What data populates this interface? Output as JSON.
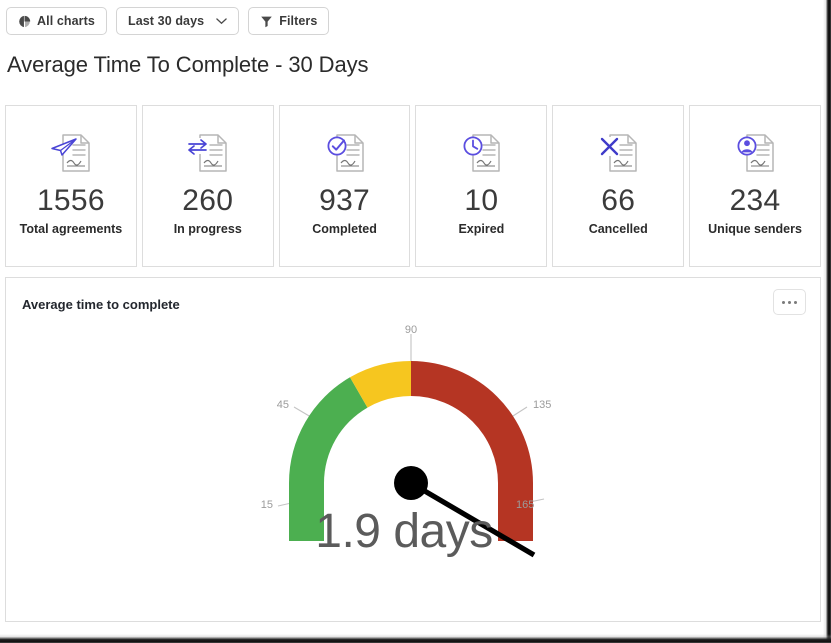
{
  "toolbar": {
    "all_charts": {
      "label": "All charts",
      "icon": "pie-chart-icon"
    },
    "date_range": {
      "label": "Last 30 days",
      "icon": "chevron-down-icon"
    },
    "filters": {
      "label": "Filters",
      "icon": "funnel-icon"
    }
  },
  "page": {
    "title": "Average Time To Complete - 30 Days"
  },
  "stats": [
    {
      "value": "1556",
      "label": "Total agreements",
      "icon": "paper-plane-document-icon",
      "accent": "#4a45d6"
    },
    {
      "value": "260",
      "label": "In progress",
      "icon": "exchange-arrows-document-icon",
      "accent": "#4a45d6"
    },
    {
      "value": "937",
      "label": "Completed",
      "icon": "check-circle-document-icon",
      "accent": "#5b4ee0"
    },
    {
      "value": "10",
      "label": "Expired",
      "icon": "clock-document-icon",
      "accent": "#5b4ee0"
    },
    {
      "value": "66",
      "label": "Cancelled",
      "icon": "x-mark-document-icon",
      "accent": "#3f3bc9"
    },
    {
      "value": "234",
      "label": "Unique senders",
      "icon": "person-circle-document-icon",
      "accent": "#5b4ee0"
    }
  ],
  "chart": {
    "title": "Average time to complete",
    "more_icon": "ellipsis-icon"
  },
  "chart_data": {
    "type": "gauge",
    "title": "Average time to complete",
    "value": 1.9,
    "value_label": "1.9 days",
    "unit": "days",
    "min": 0,
    "max": 180,
    "ticks": [
      15,
      45,
      90,
      135,
      165
    ],
    "tick_labels": [
      "15",
      "45",
      "90",
      "135",
      "165"
    ],
    "needle_angle_deg": 149,
    "bands": [
      {
        "name": "good",
        "from": 0,
        "to": 60,
        "color": "#4caf50"
      },
      {
        "name": "warning",
        "from": 60,
        "to": 90,
        "color": "#f6c61f"
      },
      {
        "name": "bad",
        "from": 90,
        "to": 180,
        "color": "#b53523"
      }
    ],
    "legend": "none",
    "grid": false
  },
  "colors": {
    "green": "#4caf50",
    "yellow": "#f6c61f",
    "red": "#b53523",
    "needle": "#000000",
    "value_text": "#5b5b5b",
    "tick_text": "#9b9b9b",
    "accent_blue": "#5b4ee0"
  }
}
